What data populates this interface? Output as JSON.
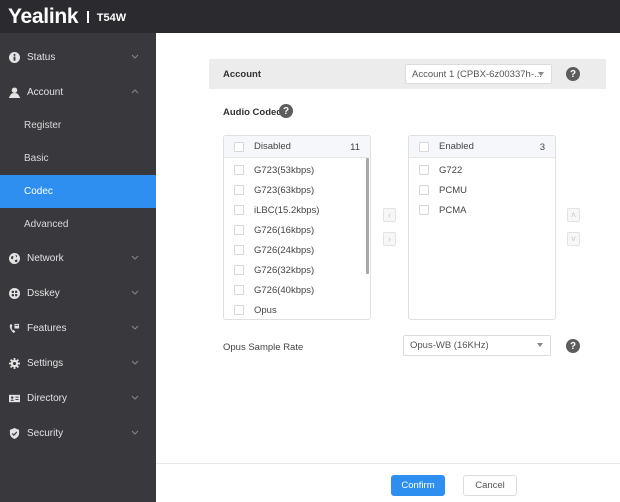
{
  "header": {
    "brand": "Yealink",
    "model": "T54W"
  },
  "sidebar": {
    "items": [
      {
        "label": "Status",
        "icon": "info-icon",
        "expanded": false
      },
      {
        "label": "Account",
        "icon": "user-icon",
        "expanded": true
      },
      {
        "label": "Network",
        "icon": "globe-icon",
        "expanded": false
      },
      {
        "label": "Dsskey",
        "icon": "grid-icon",
        "expanded": false
      },
      {
        "label": "Features",
        "icon": "phone-icon",
        "expanded": false
      },
      {
        "label": "Settings",
        "icon": "gear-icon",
        "expanded": false
      },
      {
        "label": "Directory",
        "icon": "contact-card-icon",
        "expanded": false
      },
      {
        "label": "Security",
        "icon": "shield-icon",
        "expanded": false
      }
    ],
    "account_sub": [
      {
        "label": "Register",
        "active": false
      },
      {
        "label": "Basic",
        "active": false
      },
      {
        "label": "Codec",
        "active": true
      },
      {
        "label": "Advanced",
        "active": false
      }
    ],
    "active_color": "#2f8ff0"
  },
  "main": {
    "account": {
      "label": "Account",
      "selected": "Account 1 (CPBX-6z00337h-..."
    },
    "audio_codec": {
      "title": "Audio Codec",
      "disabled": {
        "header": "Disabled",
        "count": "11",
        "items": [
          "G723(53kbps)",
          "G723(63kbps)",
          "iLBC(15.2kbps)",
          "G726(16kbps)",
          "G726(24kbps)",
          "G726(32kbps)",
          "G726(40kbps)",
          "Opus"
        ]
      },
      "enabled": {
        "header": "Enabled",
        "count": "3",
        "items": [
          "G722",
          "PCMU",
          "PCMA"
        ]
      },
      "move_left": "‹",
      "move_right": "›",
      "move_up": "˄",
      "move_down": "˅"
    },
    "opus": {
      "label": "Opus Sample Rate",
      "selected": "Opus-WB (16KHz)"
    },
    "help_glyph": "?",
    "buttons": {
      "confirm": "Confirm",
      "cancel": "Cancel"
    }
  }
}
